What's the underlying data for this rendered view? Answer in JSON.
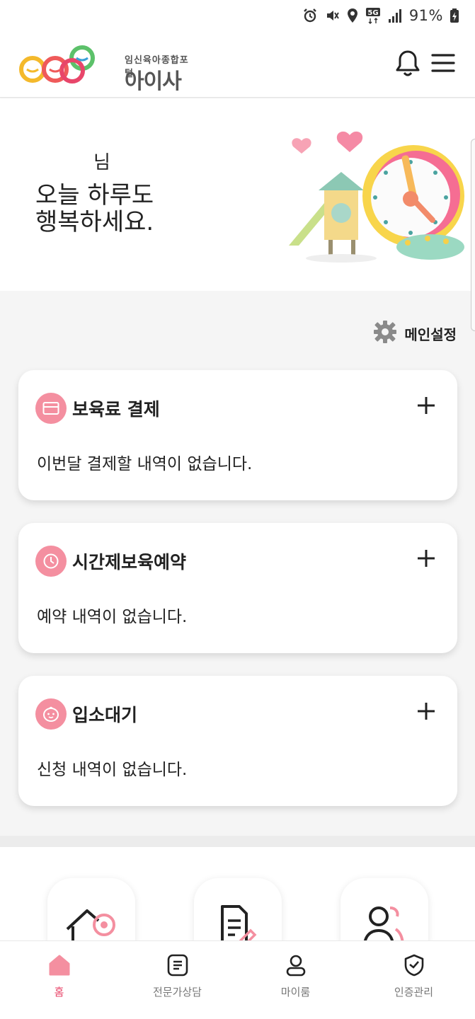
{
  "status_bar": {
    "network": "5G",
    "battery": "91%",
    "icons": [
      "alarm-icon",
      "vibrate-off-icon",
      "location-icon",
      "network-5g-icon",
      "signal-icon",
      "battery-charging-icon"
    ]
  },
  "header": {
    "logo_subtitle": "임신육아종합포털",
    "logo_title": "아이사랑",
    "icons": [
      "bell-icon",
      "hamburger-menu-icon"
    ]
  },
  "hero": {
    "name_suffix": "님",
    "greeting": "오늘 하루도\n행복하세요."
  },
  "settings": {
    "label": "메인설정",
    "icon": "gear-icon"
  },
  "cards": [
    {
      "title": "보육료 결제",
      "empty_text": "이번달 결제할 내역이 없습니다.",
      "icon": "card-icon"
    },
    {
      "title": "시간제보육예약",
      "empty_text": "예약 내역이 없습니다.",
      "icon": "clock-icon"
    },
    {
      "title": "입소대기",
      "empty_text": "신청 내역이 없습니다.",
      "icon": "baby-face-icon"
    }
  ],
  "quick_tiles": [
    "house-location-icon",
    "document-edit-icon",
    "people-icon"
  ],
  "bottom_nav": [
    {
      "label": "홈",
      "icon": "home-icon",
      "active": true
    },
    {
      "label": "전문가상담",
      "icon": "document-list-icon",
      "active": false
    },
    {
      "label": "마이룸",
      "icon": "person-icon",
      "active": false
    },
    {
      "label": "인증관리",
      "icon": "shield-check-icon",
      "active": false
    }
  ],
  "colors": {
    "accent_pink": "#f48fa0",
    "active_nav": "#e8466a",
    "background": "#f5f5f5",
    "text": "#222222"
  }
}
